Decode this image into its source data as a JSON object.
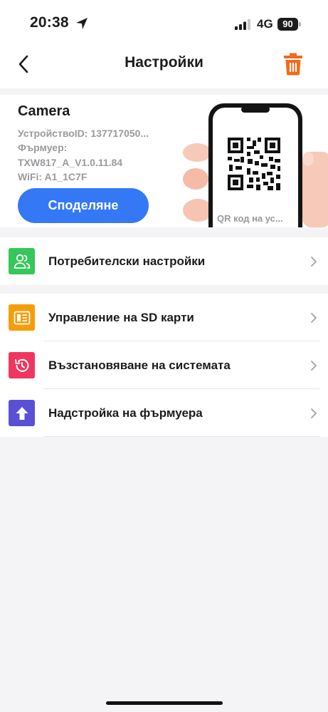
{
  "status_bar": {
    "time": "20:38",
    "network": "4G",
    "battery": "90"
  },
  "header": {
    "title": "Настройки"
  },
  "device": {
    "name": "Camera",
    "device_id": "УстройствоID: 137717050...",
    "firmware_label": "Фърмуер:",
    "firmware_version": "TXW817_A_V1.0.11.84",
    "wifi": "WiFi: A1_1C7F",
    "share_label": "Споделяне",
    "qr_caption": "QR код на ус..."
  },
  "groups": [
    {
      "items": [
        {
          "label": "Потребителски настройки",
          "icon": "users-icon",
          "color": "#34c759"
        }
      ]
    },
    {
      "items": [
        {
          "label": "Управление на SD карти",
          "icon": "sd-card-icon",
          "color": "#f59e0b"
        },
        {
          "label": "Възстановяване на системата",
          "icon": "restore-icon",
          "color": "#f0365f"
        },
        {
          "label": "Надстройка на фърмуера",
          "icon": "upgrade-icon",
          "color": "#5b4fd6"
        }
      ]
    }
  ],
  "colors": {
    "accent": "#3478f6",
    "trash": "#f26a1b",
    "background": "#f4f4f6"
  }
}
